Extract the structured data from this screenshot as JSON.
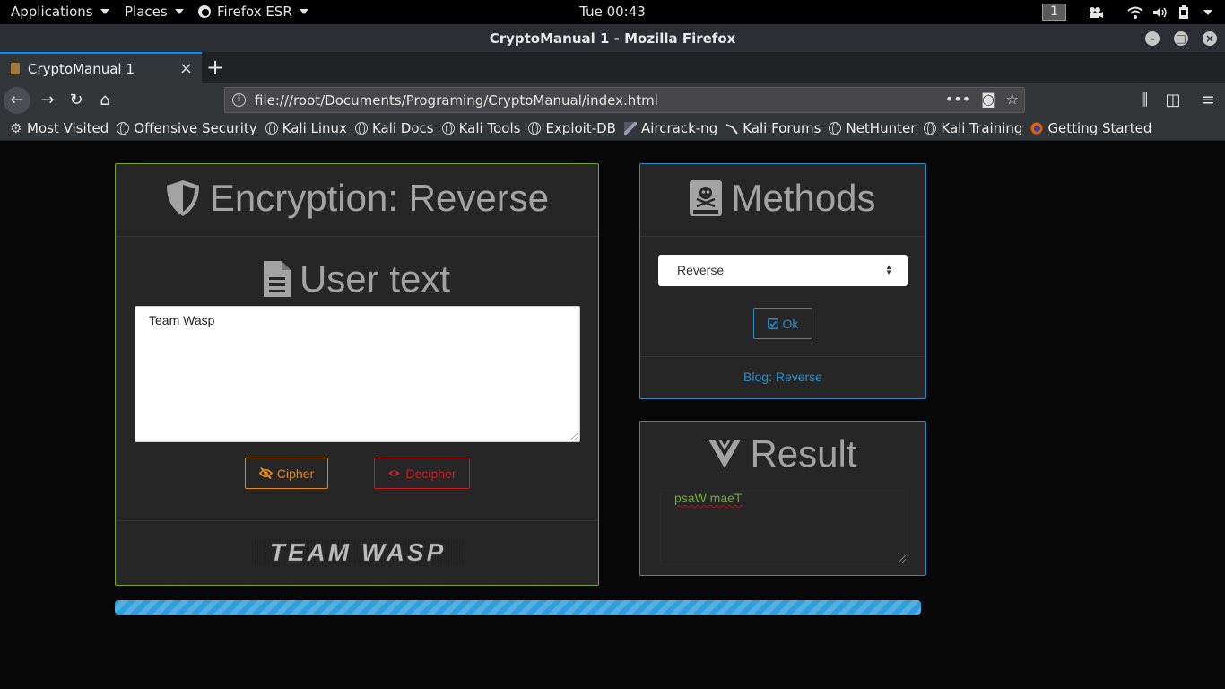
{
  "topbar": {
    "applications": "Applications",
    "places": "Places",
    "firefox": "Firefox ESR",
    "clock": "Tue 00:43",
    "workspace": "1"
  },
  "window": {
    "title": "CryptoManual 1 - Mozilla Firefox"
  },
  "tabs": [
    {
      "label": "CryptoManual 1"
    }
  ],
  "navbar": {
    "url": "file:///root/Documents/Programing/CryptoManual/index.html"
  },
  "bookmarks": [
    {
      "label": "Most Visited",
      "icon": "gear-icon"
    },
    {
      "label": "Offensive Security",
      "icon": "globe-icon"
    },
    {
      "label": "Kali Linux",
      "icon": "globe-icon"
    },
    {
      "label": "Kali Docs",
      "icon": "globe-icon"
    },
    {
      "label": "Kali Tools",
      "icon": "globe-icon"
    },
    {
      "label": "Exploit-DB",
      "icon": "globe-icon"
    },
    {
      "label": "Aircrack-ng",
      "icon": "aircrack-icon"
    },
    {
      "label": "Kali Forums",
      "icon": "kali-dragon-icon"
    },
    {
      "label": "NetHunter",
      "icon": "globe-icon"
    },
    {
      "label": "Kali Training",
      "icon": "globe-icon"
    },
    {
      "label": "Getting Started",
      "icon": "firefox-icon"
    }
  ],
  "encryption": {
    "title": "Encryption: Reverse",
    "subtitle": "User text",
    "user_text": "Team Wasp",
    "cipher_label": "Cipher",
    "decipher_label": "Decipher",
    "logo_text": "TEAM WASP"
  },
  "methods": {
    "title": "Methods",
    "selected": "Reverse",
    "ok_label": "Ok",
    "blog_link": "Blog: Reverse"
  },
  "result": {
    "title": "Result",
    "output": "psaW maeT"
  },
  "progress": {
    "percent": 100
  },
  "colors": {
    "encryption_border": "#7aa329",
    "methods_border": "#2e8ac7",
    "cipher": "#e48a17",
    "decipher": "#c62020",
    "result_text": "#6ab02e",
    "progress": "#2f9fdc"
  }
}
